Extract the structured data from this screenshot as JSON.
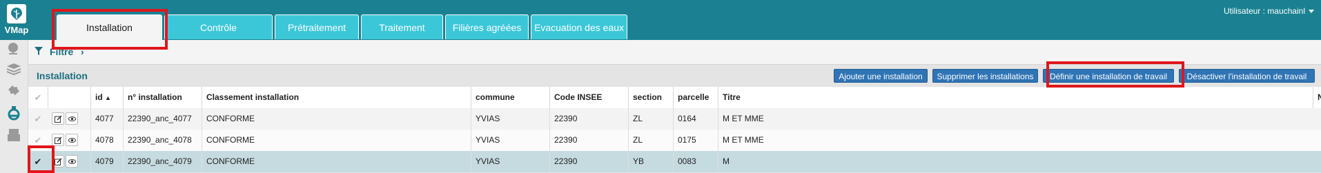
{
  "app": {
    "name": "VMap"
  },
  "user": {
    "label": "Utilisateur : mauchainl"
  },
  "tabs": [
    {
      "label": "Installation",
      "active": true
    },
    {
      "label": "Contrôle",
      "active": false
    },
    {
      "label": "Prétraitement",
      "active": false
    },
    {
      "label": "Traitement",
      "active": false
    },
    {
      "label": "Filières agréées",
      "active": false
    },
    {
      "label": "Evacuation des eaux",
      "active": false
    }
  ],
  "sidebar": {
    "items": [
      "globe-icon",
      "layers-icon",
      "puzzle-icon",
      "flask-icon",
      "printer-icon"
    ]
  },
  "filter": {
    "label": "Filtre",
    "chevron": "›"
  },
  "panel": {
    "title": "Installation",
    "buttons": {
      "add": "Ajouter une installation",
      "delete": "Supprimer les installations",
      "define": "Définir une installation de travail",
      "disable": "Désactiver l'installation de travail"
    }
  },
  "table": {
    "headers": {
      "id": "id",
      "sort": "▲",
      "num": "n° installation",
      "classement": "Classement installation",
      "commune": "commune",
      "insee": "Code INSEE",
      "section": "section",
      "parcelle": "parcelle",
      "titre": "Titre",
      "extra": "N"
    },
    "rows": [
      {
        "id": "4077",
        "num": "22390_anc_4077",
        "classement": "CONFORME",
        "commune": "YVIAS",
        "insee": "22390",
        "section": "ZL",
        "parcelle": "0164",
        "titre": "M ET MME",
        "selected": false
      },
      {
        "id": "4078",
        "num": "22390_anc_4078",
        "classement": "CONFORME",
        "commune": "YVIAS",
        "insee": "22390",
        "section": "ZL",
        "parcelle": "0175",
        "titre": "M ET MME",
        "selected": false
      },
      {
        "id": "4079",
        "num": "22390_anc_4079",
        "classement": "CONFORME",
        "commune": "YVIAS",
        "insee": "22390",
        "section": "YB",
        "parcelle": "0083",
        "titre": "M",
        "selected": true
      }
    ]
  },
  "colors": {
    "header": "#1b8192",
    "tab": "#3cc7d9",
    "button": "#2f74b5",
    "highlight": "#e0161b",
    "selected_row": "#c6dbe0"
  }
}
